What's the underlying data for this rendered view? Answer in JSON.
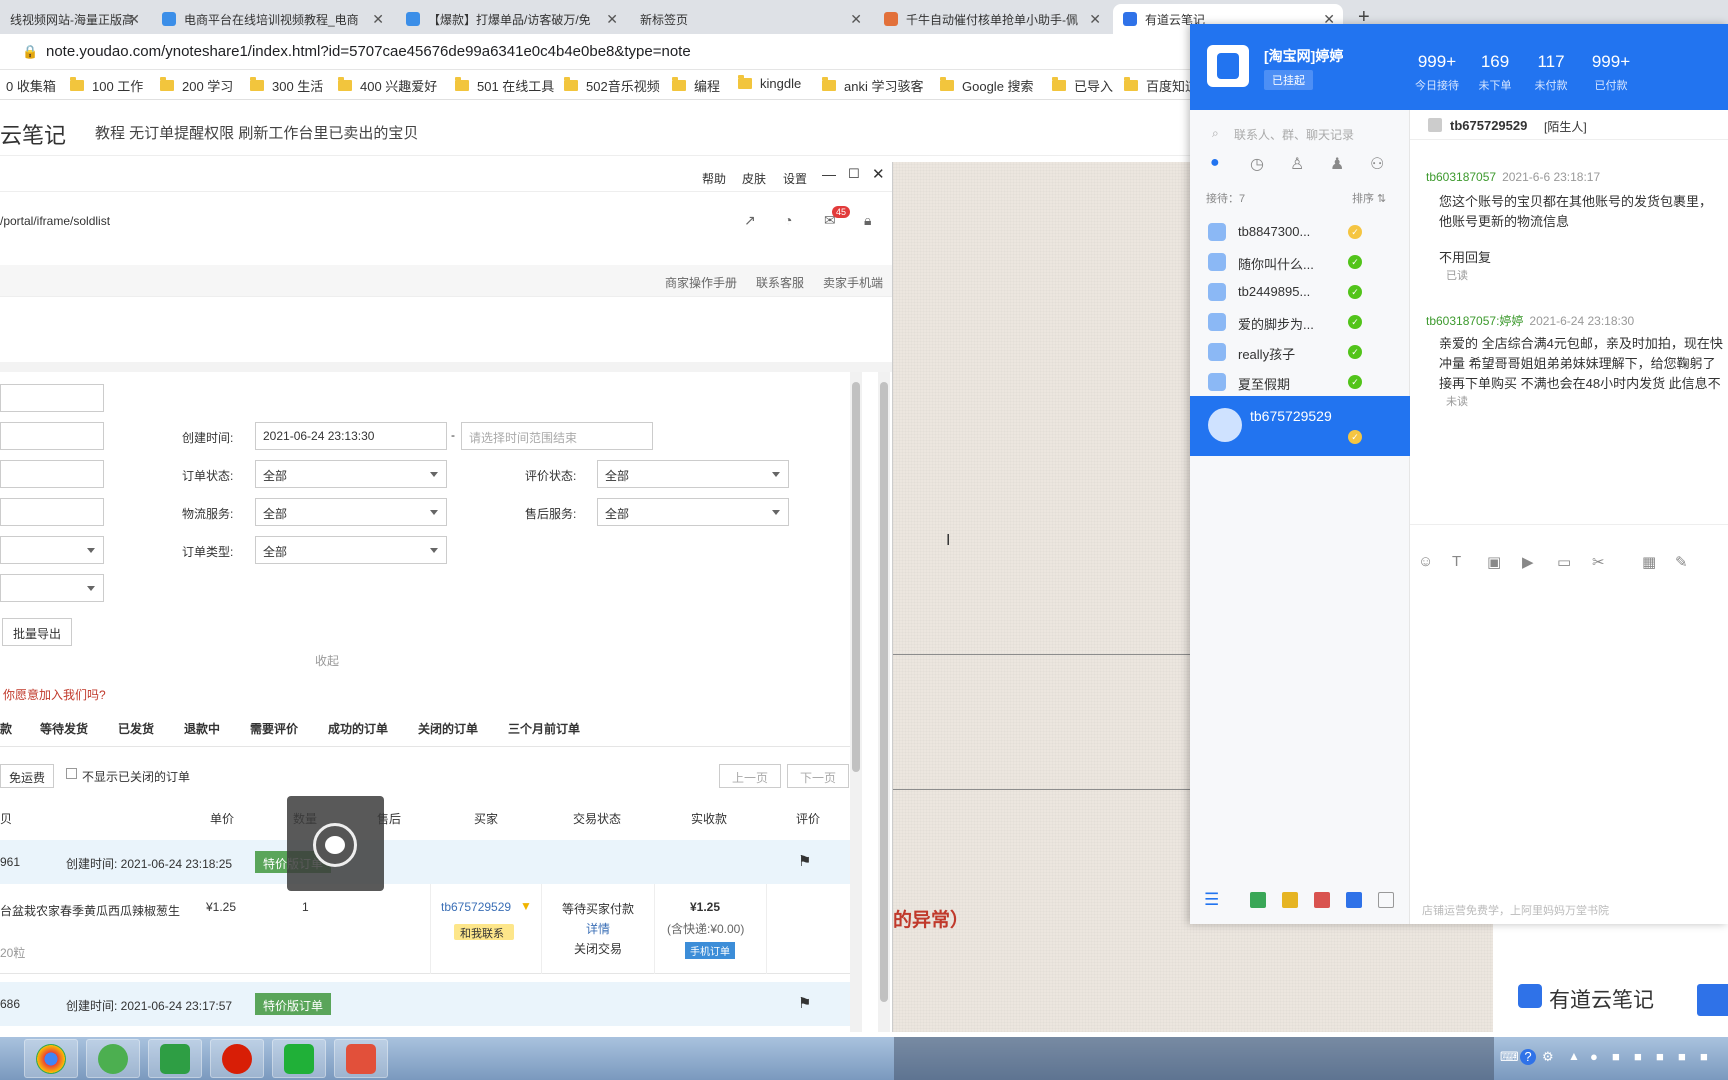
{
  "tabs": [
    {
      "label": "线视频网站-海量正版高",
      "active": false
    },
    {
      "label": "电商平台在线培训视频教程_电商",
      "active": false
    },
    {
      "label": "【爆款】打爆单品/访客破万/免",
      "active": false
    },
    {
      "label": "新标签页",
      "active": false
    },
    {
      "label": "千牛自动催付核单抢单小助手-佩",
      "active": false
    },
    {
      "label": "有道云笔记",
      "active": true
    }
  ],
  "url": "note.youdao.com/ynoteshare1/index.html?id=5707cae45676de99a6341e0c4b4e0be8&type=note",
  "bookmarks": [
    "0 收集箱",
    "100 工作",
    "200 学习",
    "300 生活",
    "400 兴趣爱好",
    "501 在线工具",
    "502音乐视频",
    "编程",
    "kingdle",
    "anki 学习骇客",
    "Google 搜索",
    "已导入",
    "百度知道"
  ],
  "youdao": {
    "logo": "云笔记",
    "note_title": "教程 无订单提醒权限 刷新工作台里已卖出的宝贝",
    "brand": "有道云笔记"
  },
  "seller": {
    "top_links": [
      "帮助",
      "皮肤",
      "设置"
    ],
    "path": "/portal/iframe/soldlist",
    "mail_count": "45",
    "sub_links": [
      "商家操作手册",
      "联系客服",
      "卖家手机端"
    ],
    "filters": {
      "create_time_label": "创建时间:",
      "create_time_start": "2021-06-24 23:13:30",
      "create_time_end_placeholder": "请选择时间范围结束",
      "order_status_label": "订单状态:",
      "order_status": "全部",
      "review_status_label": "评价状态:",
      "review_status": "全部",
      "logistics_label": "物流服务:",
      "logistics": "全部",
      "aftersale_label": "售后服务:",
      "aftersale": "全部",
      "order_type_label": "订单类型:",
      "order_type": "全部"
    },
    "export_button": "批量导出",
    "collapse": "收起",
    "join_prompt": "你愿意加入我们吗?",
    "status_tabs": [
      "款",
      "等待发货",
      "已发货",
      "退款中",
      "需要评价",
      "成功的订单",
      "关闭的订单",
      "三个月前订单"
    ],
    "free_ship_btn": "免运费",
    "hide_closed": "不显示已关闭的订单",
    "prev": "上一页",
    "next": "下一页",
    "columns": [
      "贝",
      "单价",
      "数量",
      "售后",
      "买家",
      "交易状态",
      "实收款",
      "评价"
    ],
    "orders": [
      {
        "id_tail": "961",
        "created": "创建时间: 2021-06-24 23:18:25",
        "tag": "特价版订单",
        "item": "台盆栽农家春季黄瓜西瓜辣椒葱生",
        "spec": "20粒",
        "price": "¥1.25",
        "qty": "1",
        "buyer": "tb675729529",
        "contact": "和我联系",
        "status": "等待买家付款",
        "detail": "详情",
        "close": "关闭交易",
        "paid": "¥1.25",
        "shipping": "(含快递:¥0.00)",
        "phone_order": "手机订单"
      },
      {
        "id_tail": "686",
        "created": "创建时间: 2021-06-24 23:17:57",
        "tag": "特价版订单"
      }
    ],
    "red_text": "的异常）"
  },
  "qianniu": {
    "shop": "[淘宝网]婷婷",
    "status": "已挂起",
    "stats": [
      {
        "num": "999+",
        "label": "今日接待"
      },
      {
        "num": "169",
        "label": "未下单"
      },
      {
        "num": "117",
        "label": "未付款"
      },
      {
        "num": "999+",
        "label": "已付款"
      }
    ],
    "search_placeholder": "联系人、群、聊天记录",
    "reception": "接待：7",
    "sort": "排序 ⇅",
    "contacts": [
      "tb8847300...",
      "随你叫什么...",
      "tb2449895...",
      "爱的脚步为...",
      "really孩子",
      "夏至假期",
      "tb675729529"
    ],
    "chat_title": "tb675729529",
    "chat_tag": "[陌生人]",
    "messages": [
      {
        "from": "tb603187057",
        "time": "2021-6-6 23:18:17",
        "lines": [
          "您这个账号的宝贝都在其他账号的发货包裹里，",
          "他账号更新的物流信息"
        ]
      },
      {
        "from": "",
        "time": "",
        "lines": [
          "不用回复"
        ],
        "read": "已读"
      },
      {
        "from": "tb603187057:婷婷",
        "time": "2021-6-24 23:18:30",
        "lines": [
          "亲爱的 全店综合满4元包邮，亲及时加拍，现在快",
          "冲量 希望哥哥姐姐弟弟妹妹理解下，给您鞠躬了",
          "接再下单购买 不满也会在48小时内发货 此信息不"
        ],
        "read": "未读"
      }
    ],
    "footer": "店铺运营免费学，上阿里妈妈万堂书院"
  }
}
